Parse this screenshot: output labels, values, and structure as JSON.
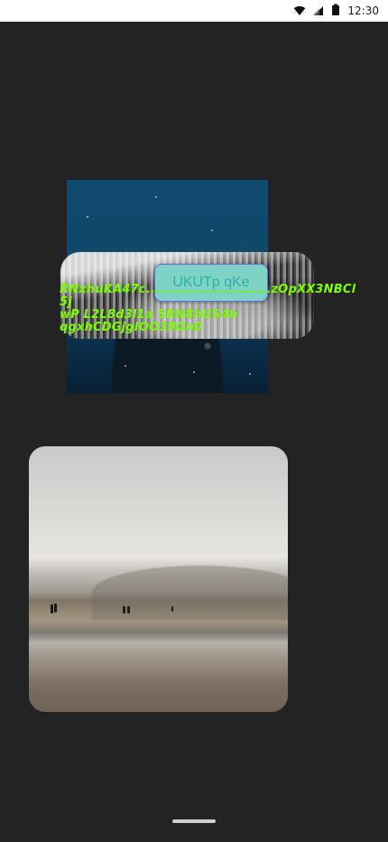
{
  "status_bar": {
    "time": "12:30",
    "icons": [
      "wifi-icon",
      "signal-icon",
      "battery-icon"
    ]
  },
  "images": {
    "underwater": {
      "name": "underwater-photo"
    },
    "forest": {
      "name": "snowy-forest-photo"
    },
    "beach": {
      "name": "beach-photo"
    }
  },
  "button": {
    "label": "UKUTp  qKe"
  },
  "overlay_text": {
    "lines": [
      "RNxhuKA47c...........................zOpXX3NBCl",
      "5j",
      "wP  L2L8d3l1a SRN8hUS4b",
      "qgxhCDGjgIOO39Gn0"
    ]
  },
  "colors": {
    "background": "#232323",
    "button_bg": "#7fd3c6",
    "button_text": "#2ab3a3",
    "overlay_text": "#7cff00"
  }
}
